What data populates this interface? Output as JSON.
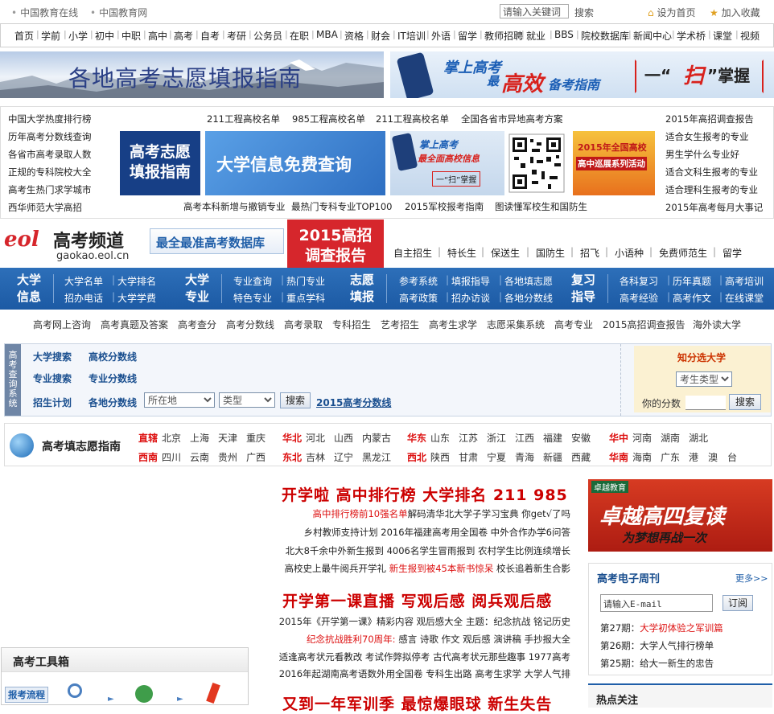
{
  "topbar": {
    "links": [
      "中国教育在线",
      "中国教育网"
    ],
    "search_placeholder": "请输入关键词",
    "search_label": "搜索",
    "home_label": "设为首页",
    "fav_label": "加入收藏"
  },
  "mainnav": [
    "首页",
    "学前",
    "小学",
    "初中",
    "中职",
    "高中",
    "高考",
    "自考",
    "考研",
    "公务员",
    "在职",
    "MBA",
    "资格",
    "财会",
    "IT培训",
    "外语",
    "留学",
    "教师招聘",
    "就业",
    "BBS",
    "院校数据库",
    "新闻中心",
    "学术桥",
    "课堂",
    "视频"
  ],
  "banner_left": "各地高考志愿填报指南",
  "banner_right": {
    "line1": "掌上高考",
    "line2a": "最",
    "line2b": "高效",
    "line2c": "备考指南",
    "slogan_a": "一“",
    "slogan_b": "扫",
    "slogan_c": "”掌握"
  },
  "left_links": [
    "中国大学热度排行榜",
    "历年高考分数线查询",
    "各省市高考录取人数",
    "正规的专科院校大全",
    "高考生热门求学城市",
    "西华师范大学高招"
  ],
  "center_top_links": [
    "211工程高校名单",
    "985工程高校名单",
    "211工程高校名单",
    "全国各省市异地高考方案"
  ],
  "center_bottom_links": [
    "高考本科新增与撤销专业",
    "最热门专科专业TOP100",
    "2015军校报考指南",
    "图读懂军校生和国防生"
  ],
  "right_links": [
    "2015年高招调查报告",
    "适合女生报考的专业",
    "男生学什么专业好",
    "适合文科生报考的专业",
    "适合理科生报考的专业",
    "2015年高考每月大事记"
  ],
  "promos": {
    "blue1_a": "高考志愿",
    "blue1_b": "填报指南",
    "blue2": "大学信息免费查询",
    "phone_a": "掌上高考",
    "phone_b": "最全面高校信息",
    "phone_c": "一“扫”掌握",
    "red_a": "2015年全国高校",
    "red_b": "高中巡展系列活动"
  },
  "channel": {
    "logo_text": "eol",
    "title": "高考频道",
    "domain": "gaokao.eol.cn",
    "slogan": "最全最准高考数据库",
    "report_a": "2015高招",
    "report_b": "调查报告",
    "links": [
      "自主招生",
      "特长生",
      "保送生",
      "国防生",
      "招飞",
      "小语种",
      "免费师范生",
      "留学"
    ]
  },
  "bluenav": {
    "groups": [
      {
        "title1": "大学",
        "title2": "信息",
        "row1": [
          "大学名单",
          "大学排名"
        ],
        "row2": [
          "招办电话",
          "大学学费"
        ]
      },
      {
        "title1": "大学",
        "title2": "专业",
        "row1": [
          "专业查询",
          "热门专业"
        ],
        "row2": [
          "特色专业",
          "重点学科"
        ]
      },
      {
        "title1": "志愿",
        "title2": "填报",
        "row1": [
          "参考系统",
          "填报指导",
          "各地填志愿"
        ],
        "row2": [
          "高考政策",
          "招办访谈",
          "各地分数线"
        ]
      },
      {
        "title1": "复习",
        "title2": "指导",
        "row1": [
          "各科复习",
          "历年真题",
          "高考培训"
        ],
        "row2": [
          "高考经验",
          "高考作文",
          "在线课堂"
        ]
      }
    ]
  },
  "graylinks": [
    "高考网上咨询",
    "高考真题及答案",
    "高考查分",
    "高考分数线",
    "高考录取",
    "专科招生",
    "艺考招生",
    "高考生求学",
    "志愿采集系统",
    "高考专业",
    "2015高招调查报告",
    "海外读大学"
  ],
  "query": {
    "side": "高考查询系统",
    "l1": "大学搜索",
    "l2": "高校分数线",
    "l3": "专业搜索",
    "l4": "专业分数线",
    "l5": "招生计划",
    "l6": "各地分数线",
    "sel1": "所在地",
    "sel2": "类型",
    "btn": "搜索",
    "link": "2015高考分数线",
    "score_title": "知分选大学",
    "score_sel": "考生类型",
    "score_label": "你的分数",
    "score_btn": "搜索"
  },
  "region": {
    "title": "高考填志愿指南",
    "row1": [
      {
        "zone": "直辖",
        "items": [
          "北京",
          "上海",
          "天津",
          "重庆"
        ]
      },
      {
        "zone": "华北",
        "items": [
          "河北",
          "山西",
          "内蒙古"
        ]
      },
      {
        "zone": "华东",
        "items": [
          "山东",
          "江苏",
          "浙江",
          "江西",
          "福建",
          "安徽"
        ]
      },
      {
        "zone": "华中",
        "items": [
          "河南",
          "湖南",
          "湖北"
        ]
      }
    ],
    "row2": [
      {
        "zone": "西南",
        "items": [
          "四川",
          "云南",
          "贵州",
          "广西"
        ]
      },
      {
        "zone": "东北",
        "items": [
          "吉林",
          "辽宁",
          "黑龙江"
        ]
      },
      {
        "zone": "西北",
        "items": [
          "陕西",
          "甘肃",
          "宁夏",
          "青海",
          "新疆",
          "西藏"
        ]
      },
      {
        "zone": "华南",
        "items": [
          "海南",
          "广东",
          "港",
          "澳",
          "台"
        ]
      }
    ]
  },
  "news": {
    "head1": "开学啦  高中排行榜  大学排名  211  985",
    "lines1": [
      [
        {
          "t": "高中排行榜前10强名单",
          "r": true
        },
        {
          "t": "解码清华北大学子学习宝典 你get√了吗"
        }
      ],
      [
        {
          "t": "乡村教师支持计划 2016年福建高考用全国卷 中外合作办学6问答"
        }
      ],
      [
        {
          "t": "北大8千余中外新生报到 4006名学生冒雨报到 农村学生比例连续增长"
        }
      ],
      [
        {
          "t": "高校史上最牛阅兵开学礼 "
        },
        {
          "t": "新生报到被45本新书惊呆",
          "r": true
        },
        {
          "t": " 校长追着新生合影"
        }
      ]
    ],
    "head2": "开学第一课直播  写观后感  阅兵观后感",
    "lines2": [
      [
        {
          "t": "2015年《开学第一课》精彩内容 观后感大全 主题：纪念抗战 铭记历史"
        }
      ],
      [
        {
          "t": "纪念抗战胜利70周年:",
          "r": true
        },
        {
          "t": " 感言 诗歌 作文 观后感 演讲稿 手抄报大全"
        }
      ],
      [
        {
          "t": "适逢高考状元看教改 考试作弊拟停考 古代高考状元那些趣事 1977高考"
        }
      ],
      [
        {
          "t": "2016年起湖南高考语数外用全国卷 专科生出路 高考生求学 大学人气排"
        }
      ]
    ],
    "head3": "又到一年军训季  最惊爆眼球  新生失告"
  },
  "right": {
    "ad_small": "卓越教育",
    "ad_big": "卓越高四复读",
    "ad_sub": "为梦想再战一次",
    "weekly_title": "高考电子周刊",
    "more": "更多>>",
    "email_placeholder": "请输入E-mail",
    "sub_btn": "订阅",
    "issues": [
      {
        "no": "第27期：",
        "t": "大学初体验之军训篇",
        "r": true
      },
      {
        "no": "第26期：",
        "t": "大学人气排行榜单",
        "r": false
      },
      {
        "no": "第25期：",
        "t": "给大一新生的忠告",
        "r": false
      }
    ],
    "hot_title": "热点关注"
  },
  "toolbox": {
    "title": "高考工具箱",
    "tab": "报考流程"
  },
  "colors": {
    "blue": "#1f5ea8",
    "red": "#cc0000",
    "gaokao_red": "#d6262c"
  }
}
